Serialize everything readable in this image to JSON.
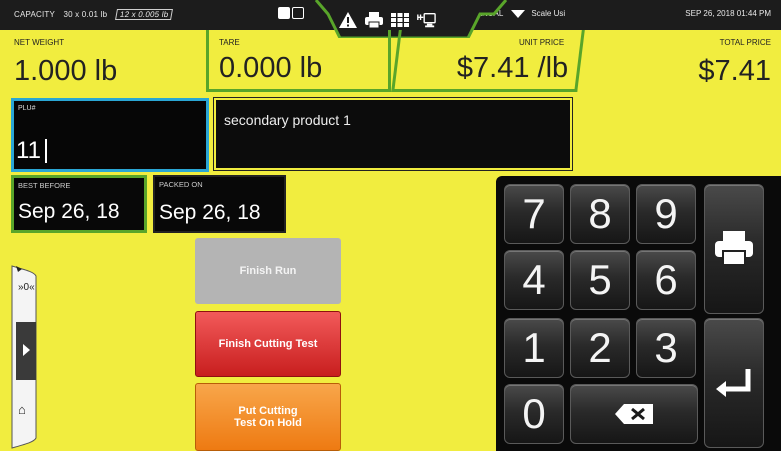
{
  "topbar": {
    "capacity_label": "CAPACITY",
    "capacity_range1": "30 x 0.01 lb",
    "capacity_range2": "12 x 0.005 lb",
    "mode": "MANUAL",
    "scale_label": "Scale Usi",
    "datetime": "SEP 26, 2018 01:44 PM",
    "status_icons": [
      "warning-icon",
      "printer-icon",
      "grid-icon",
      "network-icon"
    ]
  },
  "weights": {
    "net": {
      "label": "NET WEIGHT",
      "value": "1.000 lb"
    },
    "tare": {
      "label": "TARE",
      "value": "0.000 lb"
    },
    "unit_price": {
      "label": "UNIT PRICE",
      "value": "$7.41 /lb"
    },
    "total_price": {
      "label": "TOTAL PRICE",
      "value": "$7.41"
    }
  },
  "plu": {
    "label": "PLU#",
    "value": "11"
  },
  "product": {
    "name": "secondary product 1"
  },
  "dates": {
    "best_before": {
      "label": "BEST BEFORE",
      "value": "Sep 26, 18"
    },
    "packed_on": {
      "label": "PACKED ON",
      "value": "Sep 26, 18"
    }
  },
  "actions": {
    "finish_run": "Finish Run",
    "finish_cutting_test": "Finish Cutting Test",
    "put_on_hold_line1": "Put Cutting",
    "put_on_hold_line2": "Test On Hold"
  },
  "keypad": {
    "k7": "7",
    "k8": "8",
    "k9": "9",
    "k4": "4",
    "k5": "5",
    "k6": "6",
    "k1": "1",
    "k2": "2",
    "k3": "3",
    "k0": "0"
  },
  "colors": {
    "background": "#f1ed3f",
    "accent_green": "#59a52a",
    "focus_blue": "#2aa6d4",
    "action_red": "#d92a2a",
    "action_orange": "#f28a1e",
    "disabled_gray": "#b4b4b4"
  }
}
